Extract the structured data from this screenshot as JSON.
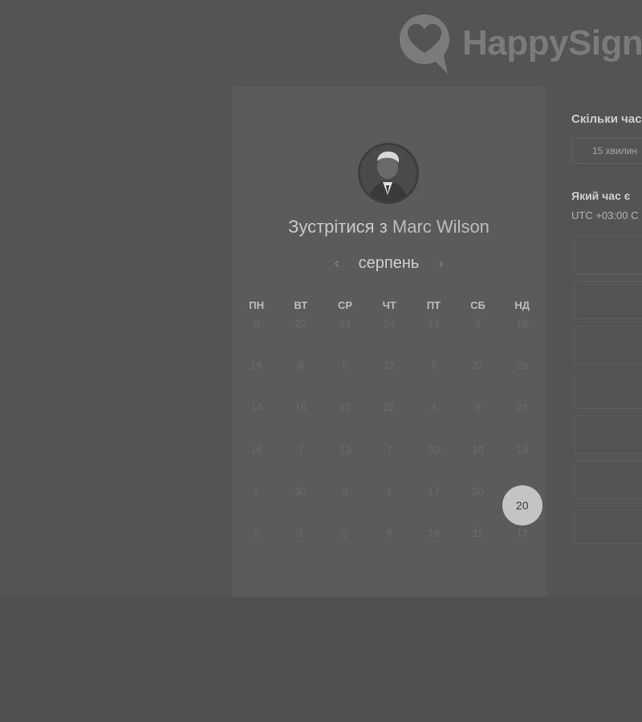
{
  "logo": {
    "text": "HappySign"
  },
  "calendar": {
    "title_prefix": "Зустрітися з",
    "host_name": "Marc Wilson",
    "month": "серпень",
    "prev_icon": "chevron-left-icon",
    "next_icon": "chevron-right-icon",
    "weekdays": [
      "ПН",
      "ВТ",
      "СР",
      "ЧТ",
      "ПТ",
      "СБ",
      "НД"
    ],
    "days": [
      "8",
      "22",
      "13",
      "24",
      "14",
      "9",
      "18",
      "19",
      "6",
      "6",
      "12",
      "7",
      "27",
      "26",
      "14",
      "16",
      "23",
      "22",
      "4",
      "8",
      "24",
      "16",
      "7",
      "13",
      "7",
      "30",
      "10",
      "19",
      "5",
      "30",
      "8",
      "1",
      "17",
      "30",
      "20",
      "5",
      "1",
      "2",
      "9",
      "19",
      "11",
      "17"
    ],
    "selected_day": "20"
  },
  "booking": {
    "question_duration": "Скільки часу",
    "duration_value": "15 хвилин",
    "question_time": "Який час є",
    "timezone": "UTC +03:00 С"
  },
  "colors": {
    "overlay": "#505050",
    "card": "#5b5b5b",
    "selected": "#c4c4c4"
  }
}
